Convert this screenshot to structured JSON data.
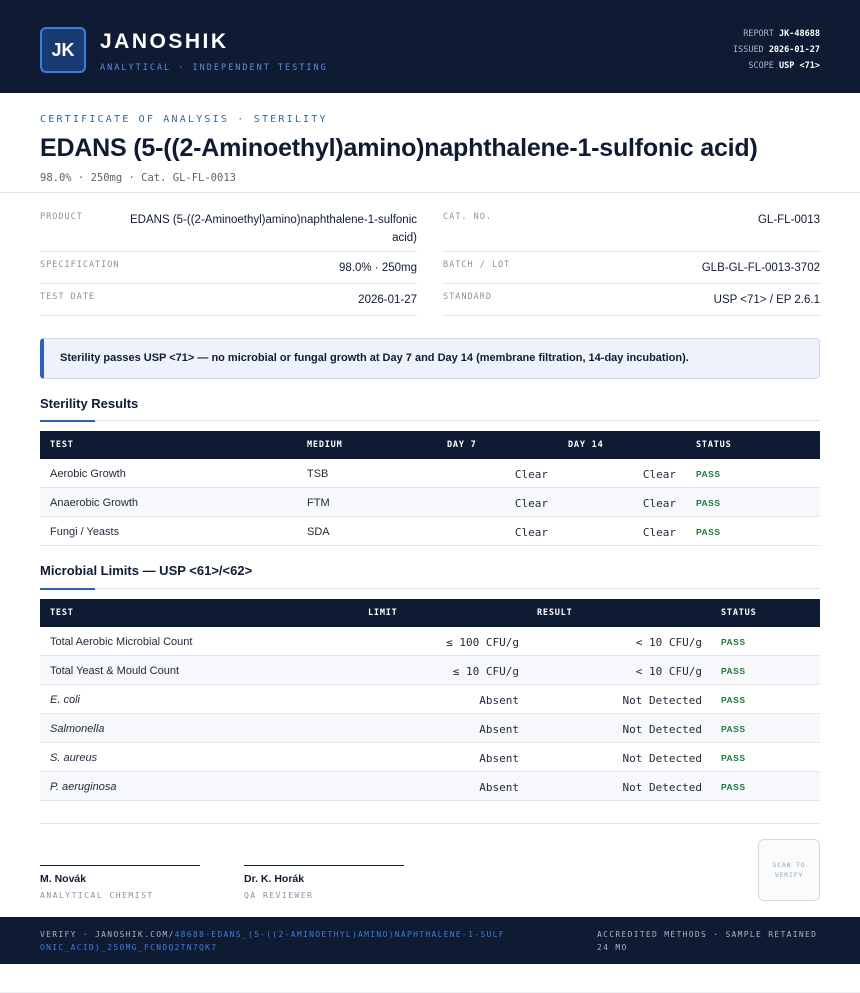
{
  "header": {
    "logo": "JK",
    "brand": "JANOSHIK",
    "tagline": "ANALYTICAL · INDEPENDENT TESTING",
    "report_label": "REPORT",
    "report_value": "JK-48688",
    "issued_label": "ISSUED",
    "issued_value": "2026-01-27",
    "scope_label": "SCOPE",
    "scope_value": "USP <71>"
  },
  "doc": {
    "eyebrow": "CERTIFICATE OF ANALYSIS · STERILITY",
    "title": "EDANS (5-((2-Aminoethyl)amino)naphthalene-1-sulfonic acid)",
    "subtitle": "98.0% · 250mg  ·  Cat. GL-FL-0013"
  },
  "info": {
    "product_label": "PRODUCT",
    "product_value": "EDANS (5-((2-Aminoethyl)amino)naphthalene-1-sulfonic acid)",
    "spec_label": "SPECIFICATION",
    "spec_value": "98.0% · 250mg",
    "date_label": "TEST DATE",
    "date_value": "2026-01-27",
    "cat_label": "CAT. NO.",
    "cat_value": "GL-FL-0013",
    "batch_label": "BATCH / LOT",
    "batch_value": "GLB-GL-FL-0013-3702",
    "standard_label": "STANDARD",
    "standard_value": "USP <71> / EP 2.6.1"
  },
  "banner": "Sterility passes USP <71> — no microbial or fungal growth at Day 7 and Day 14 (membrane filtration, 14-day incubation).",
  "sterility": {
    "title": "Sterility Results",
    "headers": [
      "TEST",
      "MEDIUM",
      "DAY 7",
      "DAY 14",
      "STATUS"
    ],
    "rows": [
      {
        "test": "Aerobic Growth",
        "medium": "TSB",
        "day7": "Clear",
        "day14": "Clear",
        "status": "PASS"
      },
      {
        "test": "Anaerobic Growth",
        "medium": "FTM",
        "day7": "Clear",
        "day14": "Clear",
        "status": "PASS"
      },
      {
        "test": "Fungi / Yeasts",
        "medium": "SDA",
        "day7": "Clear",
        "day14": "Clear",
        "status": "PASS"
      }
    ]
  },
  "microbial": {
    "title": "Microbial Limits — USP <61>/<62>",
    "headers": [
      "TEST",
      "LIMIT",
      "RESULT",
      "STATUS"
    ],
    "rows": [
      {
        "test": "Total Aerobic Microbial Count",
        "limit": "≤ 100 CFU/g",
        "result": "< 10 CFU/g",
        "status": "PASS"
      },
      {
        "test": "Total Yeast & Mould Count",
        "limit": "≤ 10 CFU/g",
        "result": "< 10 CFU/g",
        "status": "PASS"
      },
      {
        "test": "E. coli",
        "limit": "Absent",
        "result": "Not Detected",
        "status": "PASS"
      },
      {
        "test": "Salmonella",
        "limit": "Absent",
        "result": "Not Detected",
        "status": "PASS"
      },
      {
        "test": "S. aureus",
        "limit": "Absent",
        "result": "Not Detected",
        "status": "PASS"
      },
      {
        "test": "P. aeruginosa",
        "limit": "Absent",
        "result": "Not Detected",
        "status": "PASS"
      }
    ]
  },
  "signatures": [
    {
      "name": "M. Novák",
      "role": "ANALYTICAL CHEMIST"
    },
    {
      "name": "Dr. K. Horák",
      "role": "QA REVIEWER"
    }
  ],
  "qr_label": "SCAN TO VERIFY",
  "footer": {
    "verify_prefix": "VERIFY · JANOSHIK.COM/",
    "verify_link": "48688-EDANS_(5-((2-AMINOETHYL)AMINO)NAPHTHALENE-1-SULFONIC_ACID)_250MG_FCNDQ2TN7QK7",
    "right": "ACCREDITED METHODS · SAMPLE RETAINED 24 MO"
  },
  "colors": {
    "navy": "#0f1b33",
    "accent": "#2a62b8",
    "pass": "#1a7a3a"
  }
}
